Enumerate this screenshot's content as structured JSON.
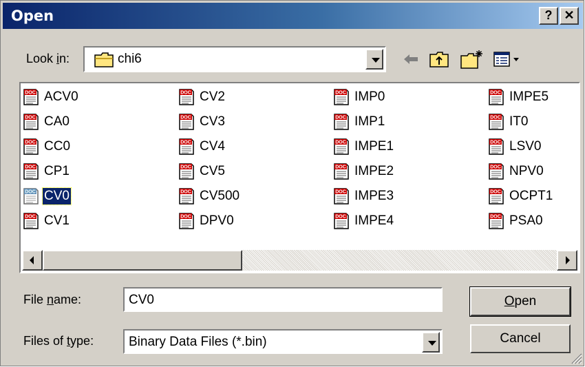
{
  "dialog": {
    "title": "Open",
    "help_glyph": "?",
    "close_glyph": "✕"
  },
  "lookin": {
    "label_pre": "Look ",
    "label_accel": "i",
    "label_post": "n:",
    "folder": "chi6",
    "folder_icon": "folder-icon"
  },
  "toolbar": {
    "icons": [
      "back-arrow-icon",
      "up-one-level-icon",
      "new-folder-icon",
      "view-menu-icon"
    ]
  },
  "files": {
    "col1": [
      "ACV0",
      "CA0",
      "CC0",
      "CP1",
      "CV0",
      "CV1"
    ],
    "col2": [
      "CV2",
      "CV3",
      "CV4",
      "CV5",
      "CV500",
      "DPV0"
    ],
    "col3": [
      "IMP0",
      "IMP1",
      "IMPE1",
      "IMPE2",
      "IMPE3",
      "IMPE4"
    ],
    "col4": [
      "IMPE5",
      "IT0",
      "LSV0",
      "NPV0",
      "OCPT1",
      "PSA0"
    ],
    "selected": "CV0",
    "file_icon": "document-icon"
  },
  "filename": {
    "label_pre": "File ",
    "label_accel": "n",
    "label_post": "ame:",
    "value": "CV0"
  },
  "filetype": {
    "label_pre": "Files of ",
    "label_accel": "t",
    "label_post": "ype:",
    "value": "Binary Data Files (*.bin)"
  },
  "buttons": {
    "open_accel": "O",
    "open_rest": "pen",
    "cancel": "Cancel"
  },
  "colors": {
    "title_start": "#0a246a",
    "title_end": "#a6caf0",
    "face": "#d4d0c8",
    "selection": "#0a246a"
  }
}
